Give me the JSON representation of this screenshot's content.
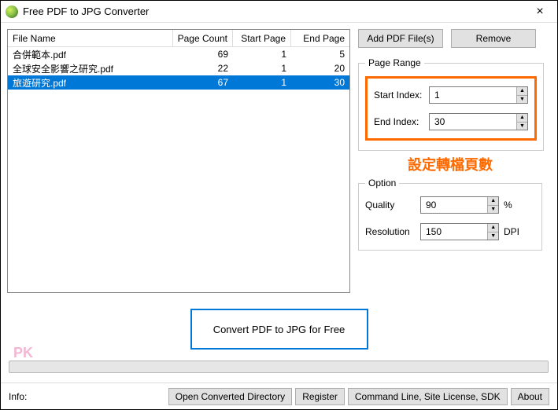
{
  "window": {
    "title": "Free PDF to JPG Converter",
    "close": "×"
  },
  "columns": {
    "filename": "File Name",
    "pagecount": "Page Count",
    "startpage": "Start Page",
    "endpage": "End Page"
  },
  "files": [
    {
      "name": "合併範本.pdf",
      "pages": "69",
      "start": "1",
      "end": "5"
    },
    {
      "name": "全球安全影響之研究.pdf",
      "pages": "22",
      "start": "1",
      "end": "20"
    },
    {
      "name": "旅遊研究.pdf",
      "pages": "67",
      "start": "1",
      "end": "30"
    }
  ],
  "buttons": {
    "add": "Add PDF File(s)",
    "remove": "Remove",
    "convert": "Convert PDF to JPG for Free",
    "opendir": "Open Converted Directory",
    "register": "Register",
    "cmdline": "Command Line, Site License, SDK",
    "about": "About"
  },
  "pageRange": {
    "legend": "Page Range",
    "startLabel": "Start Index:",
    "endLabel": "End Index:",
    "start": "1",
    "end": "30"
  },
  "option": {
    "legend": "Option",
    "qualityLabel": "Quality",
    "quality": "90",
    "qualitySuffix": "%",
    "resolutionLabel": "Resolution",
    "resolution": "150",
    "resolutionSuffix": "DPI"
  },
  "annotation": "設定轉檔頁數",
  "footer": {
    "info": "Info:"
  },
  "watermark": "PK"
}
